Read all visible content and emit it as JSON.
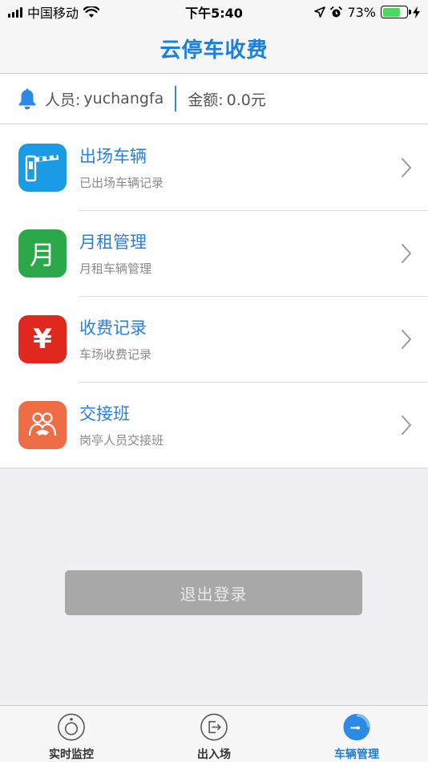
{
  "status_bar": {
    "carrier": "中国移动",
    "time": "下午5:40",
    "battery": "73%",
    "battery_level": 0.73
  },
  "nav": {
    "title": "云停车收费"
  },
  "info": {
    "person_label": "人员:",
    "person_value": "yuchangfa",
    "amount_label": "金额:",
    "amount_value": "0.0元"
  },
  "menu": {
    "items": [
      {
        "title": "出场车辆",
        "subtitle": "已出场车辆记录",
        "icon": "barrier-gate-icon",
        "color": "#1a9be6"
      },
      {
        "title": "月租管理",
        "subtitle": "月租车辆管理",
        "icon": "moon-month-icon",
        "color": "#2aa84a",
        "glyph": "月"
      },
      {
        "title": "收费记录",
        "subtitle": "车场收费记录",
        "icon": "yuan-icon",
        "color": "#e0291e",
        "glyph": "¥"
      },
      {
        "title": "交接班",
        "subtitle": "岗亭人员交接班",
        "icon": "handover-people-icon",
        "color": "#ef6d45"
      }
    ]
  },
  "logout": {
    "label": "退出登录"
  },
  "tabs": [
    {
      "label": "实时监控",
      "icon": "monitor-icon",
      "active": false
    },
    {
      "label": "出入场",
      "icon": "exit-door-icon",
      "active": false
    },
    {
      "label": "车辆管理",
      "icon": "gauge-icon",
      "active": true
    }
  ],
  "colors": {
    "accent": "#1a7fe0",
    "divider": "#2b8ae6"
  }
}
